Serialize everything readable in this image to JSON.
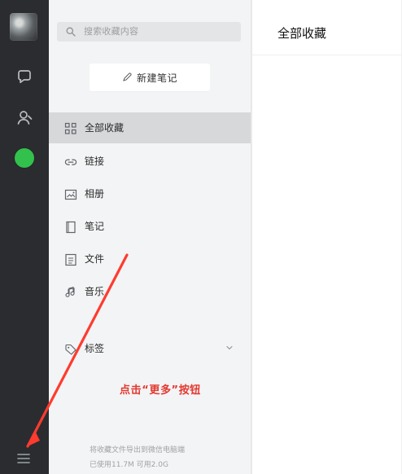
{
  "left_rail": {
    "avatar_name": "avatar",
    "icons": [
      "chat-icon",
      "contacts-icon",
      "favorites-icon",
      "menu-icon"
    ]
  },
  "middle_panel": {
    "search": {
      "placeholder": "搜索收藏内容"
    },
    "new_note": {
      "label": "新建笔记"
    },
    "nav": {
      "all": "全部收藏",
      "links": "链接",
      "images": "相册",
      "notes": "笔记",
      "files": "文件",
      "music": "音乐",
      "tags": "标签"
    },
    "callout": "点击“更多”按钮",
    "storage": {
      "line_1": "将收藏文件导出到微信电脑端",
      "line_2": "已使用11.7M  可用2.0G"
    }
  },
  "content": {
    "title": "全部收藏"
  },
  "colors": {
    "rail": "#2b2c2f",
    "panel": "#f3f4f5",
    "accent": "#32c14d",
    "annotation": "#e33830"
  }
}
